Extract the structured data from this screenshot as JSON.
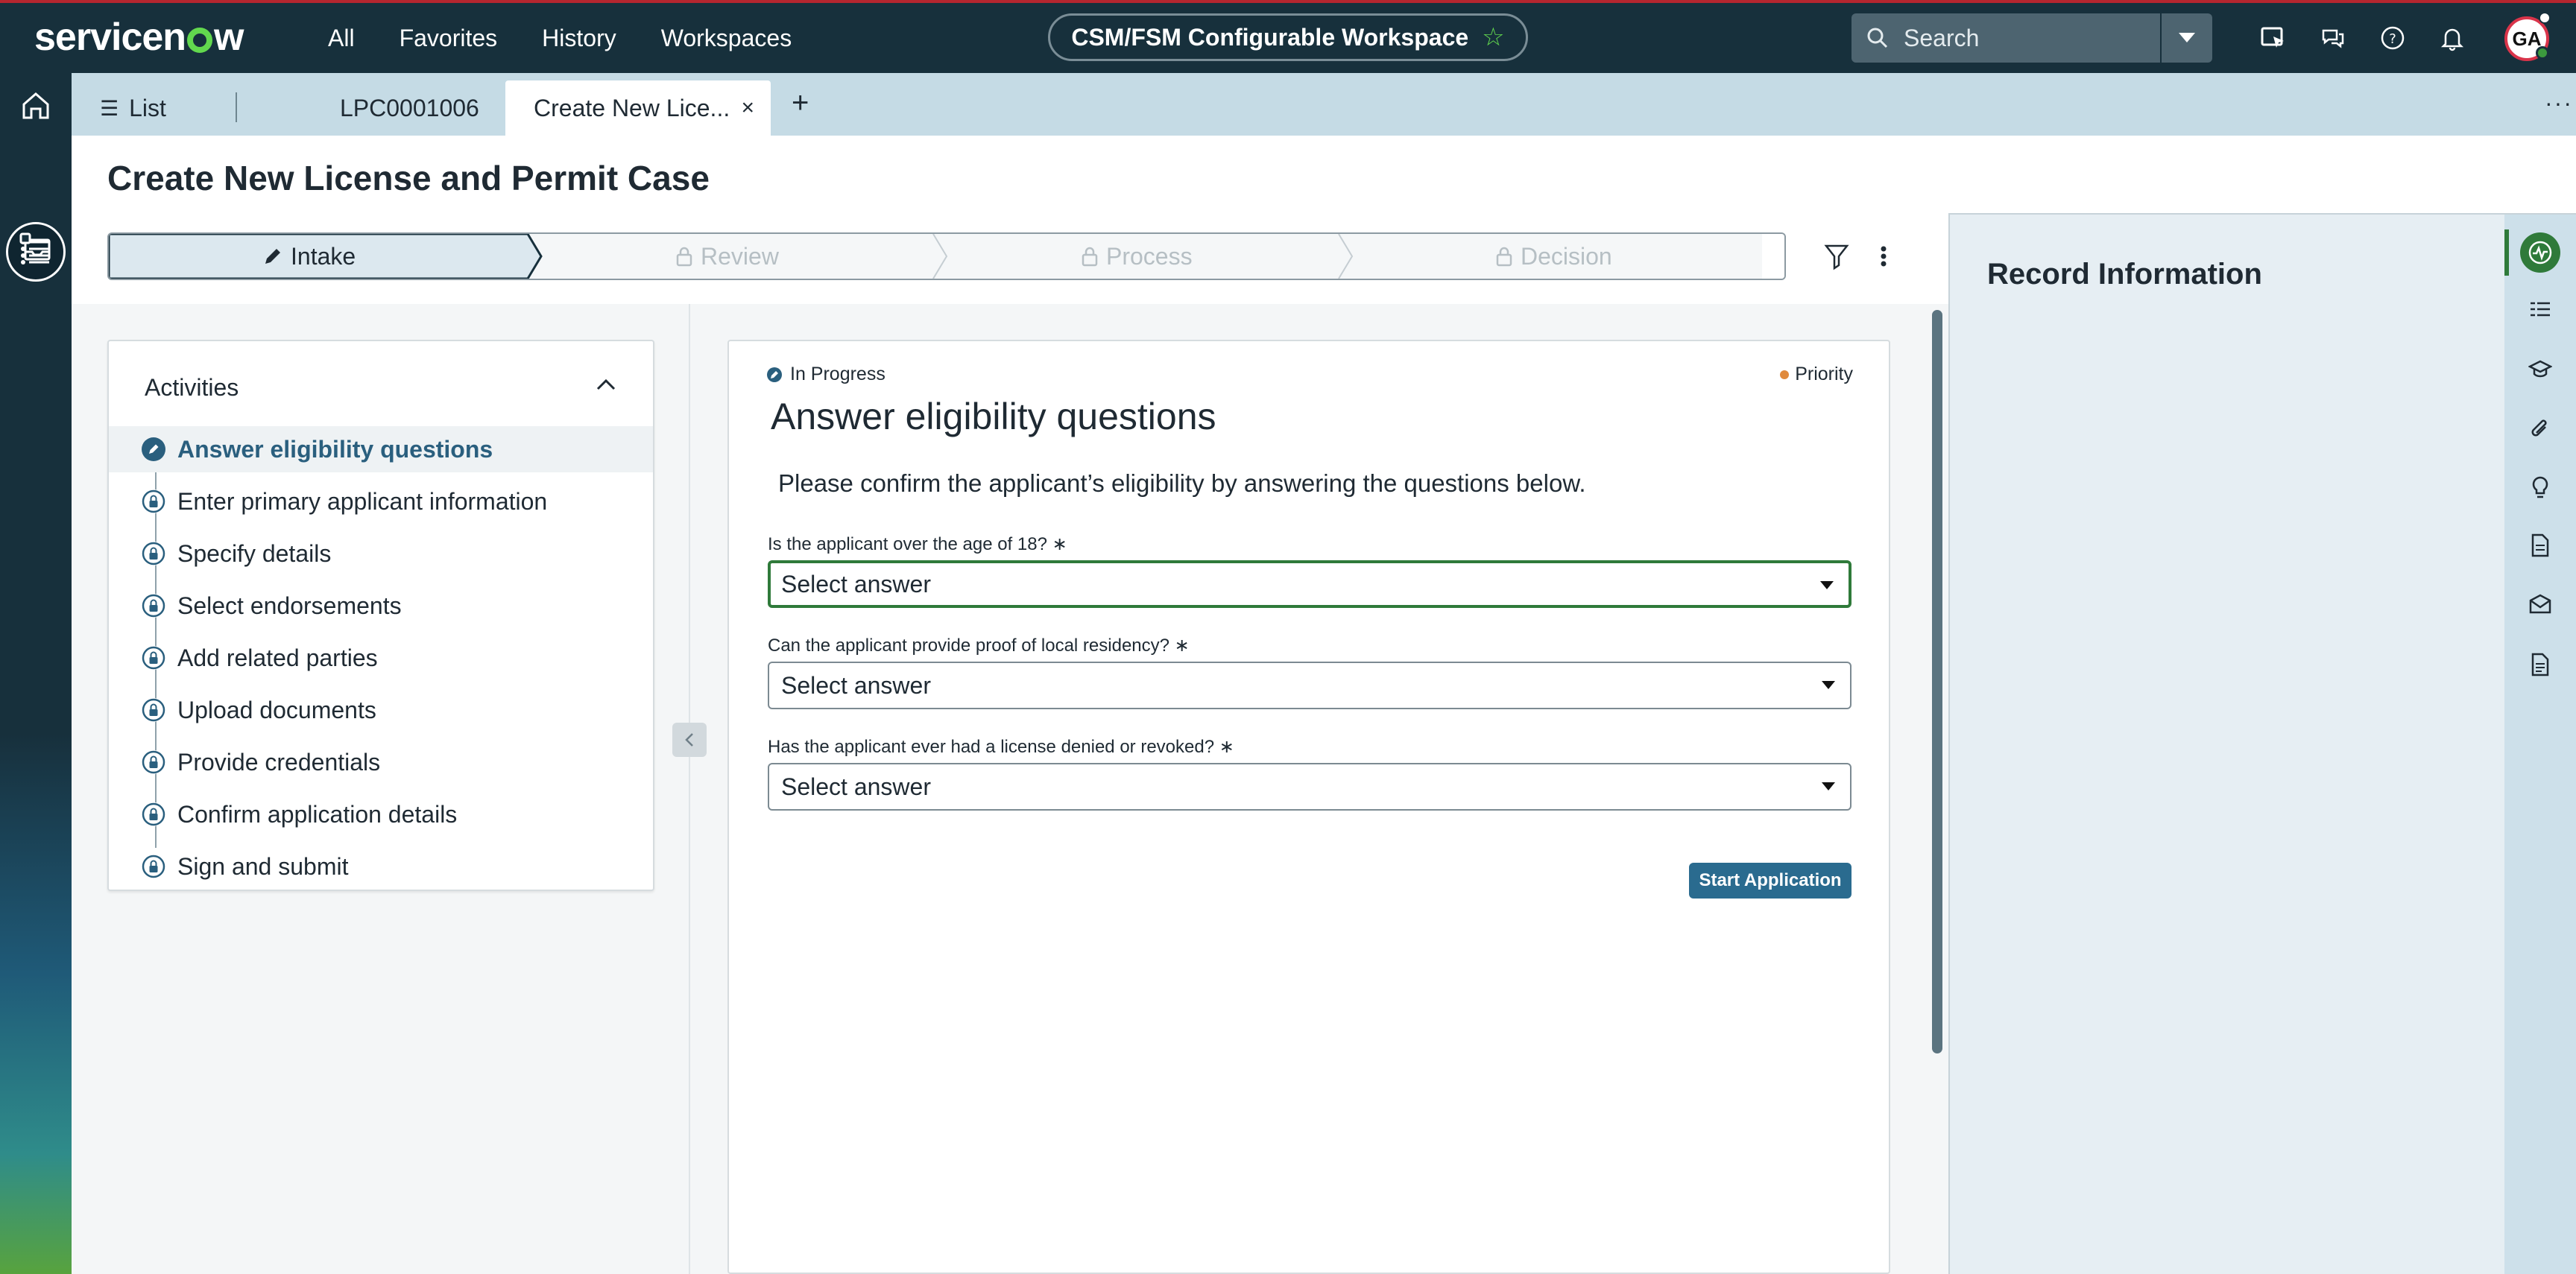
{
  "brand": {
    "name": "servicenow"
  },
  "topnav": {
    "items": [
      "All",
      "Favorites",
      "History",
      "Workspaces"
    ]
  },
  "workspace": {
    "name": "CSM/FSM Configurable Workspace"
  },
  "search": {
    "placeholder": "Search"
  },
  "user": {
    "initials": "GA"
  },
  "tabs": {
    "list_label": "List",
    "record_tab": "LPC0001006",
    "active_tab": "Create New Lice...",
    "close_glyph": "×",
    "add_glyph": "+",
    "more_glyph": "···"
  },
  "page": {
    "title": "Create New License and Permit Case"
  },
  "stages": [
    {
      "label": "Intake",
      "state": "active"
    },
    {
      "label": "Review",
      "state": "locked"
    },
    {
      "label": "Process",
      "state": "locked"
    },
    {
      "label": "Decision",
      "state": "locked"
    }
  ],
  "activities": {
    "title": "Activities",
    "items": [
      "Answer eligibility questions",
      "Enter primary applicant information",
      "Specify details",
      "Select endorsements",
      "Add related parties",
      "Upload documents",
      "Provide credentials",
      "Confirm application details",
      "Sign and submit"
    ],
    "current_index": 0
  },
  "task": {
    "status": "In Progress",
    "priority": "Priority",
    "title": "Answer eligibility questions",
    "description": "Please confirm the applicant’s eligibility by answering the questions below.",
    "questions": [
      {
        "label": "Is the applicant over the age of 18? ∗",
        "value": "Select answer"
      },
      {
        "label": "Can the applicant provide proof of local residency? ∗",
        "value": "Select answer"
      },
      {
        "label": "Has the applicant ever had a license denied or revoked? ∗",
        "value": "Select answer"
      }
    ],
    "submit_label": "Start Application"
  },
  "record_panel": {
    "title": "Record Information"
  },
  "colors": {
    "header_bg": "#17303c",
    "accent_green": "#62d84e",
    "primary_button": "#2a6b8f",
    "focus_green": "#2f7a3a",
    "priority_dot": "#e08a3c"
  }
}
